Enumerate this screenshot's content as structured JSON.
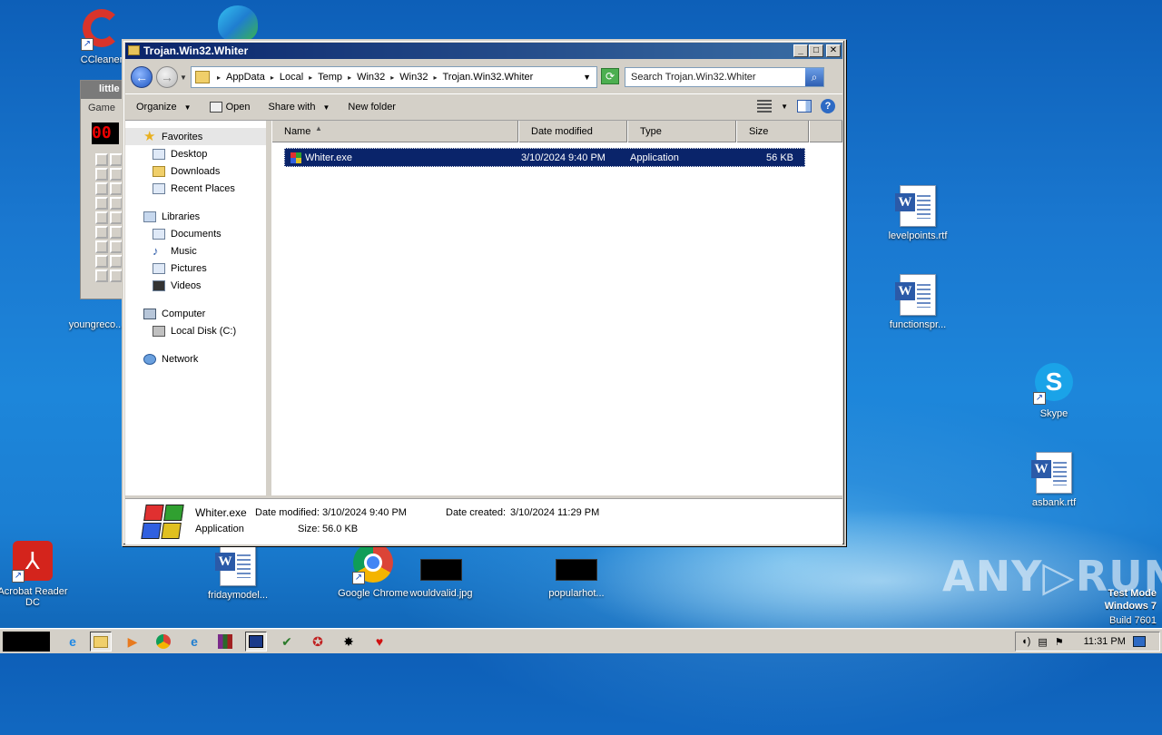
{
  "window": {
    "title": "Trojan.Win32.Whiter",
    "buttons": [
      "_",
      "□",
      "✕"
    ]
  },
  "address": {
    "crumbs": [
      "AppData",
      "Local",
      "Temp",
      "Win32",
      "Win32",
      "Trojan.Win32.Whiter"
    ],
    "search_placeholder": "Search Trojan.Win32.Whiter"
  },
  "toolbar": {
    "organize": "Organize",
    "open": "Open",
    "share_with": "Share with",
    "new_folder": "New folder"
  },
  "nav": {
    "favorites": "Favorites",
    "favorites_items": [
      "Desktop",
      "Downloads",
      "Recent Places"
    ],
    "libraries": "Libraries",
    "libraries_items": [
      "Documents",
      "Music",
      "Pictures",
      "Videos"
    ],
    "computer": "Computer",
    "computer_items": [
      "Local Disk (C:)"
    ],
    "network": "Network"
  },
  "columns": [
    "Name",
    "Date modified",
    "Type",
    "Size"
  ],
  "files": [
    {
      "name": "Whiter.exe",
      "date": "3/10/2024 9:40 PM",
      "type": "Application",
      "size": "56 KB"
    }
  ],
  "details": {
    "name": "Whiter.exe",
    "modified_label": "Date modified:",
    "modified": "3/10/2024 9:40 PM",
    "created_label": "Date created:",
    "created": "3/10/2024 11:29 PM",
    "type": "Application",
    "size_label": "Size:",
    "size": "56.0 KB"
  },
  "desktop_icons": {
    "ccleaner": "CCleaner",
    "youngreco": "youngreco...",
    "levelpoints": "levelpoints.rtf",
    "functionspr": "functionspr...",
    "skype": "Skype",
    "asbank": "asbank.rtf",
    "acrobat": "Acrobat Reader DC",
    "fridaymodel": "fridaymodel...",
    "chrome": "Google Chrome",
    "wouldvalid": "wouldvalid.jpg",
    "popularhot": "popularhot..."
  },
  "game_window": {
    "title": "little",
    "menu": "Game",
    "counter": "00"
  },
  "watermark": {
    "brand": "ANY▷RUN",
    "line1": "Test Mode",
    "line2": "Windows 7",
    "line3": "Build 7601"
  },
  "taskbar": {
    "clock": "11:31 PM"
  },
  "colors": {
    "selection": "#0a246a",
    "titlebar": "#0a246a"
  }
}
